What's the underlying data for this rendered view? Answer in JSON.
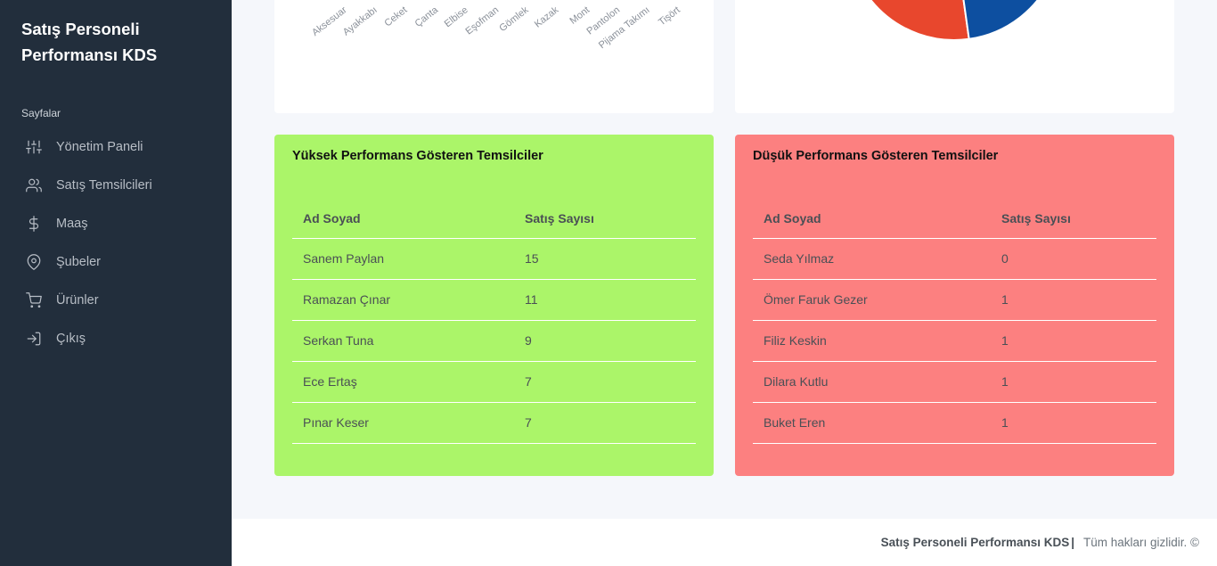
{
  "sidebar": {
    "brand": "Satış Personeli Performansı KDS",
    "header": "Sayfalar",
    "items": [
      {
        "label": "Yönetim Paneli",
        "icon": "sliders-icon"
      },
      {
        "label": "Satış Temsilcileri",
        "icon": "users-icon"
      },
      {
        "label": "Maaş",
        "icon": "dollar-icon"
      },
      {
        "label": "Şubeler",
        "icon": "map-pin-icon"
      },
      {
        "label": "Ürünler",
        "icon": "cart-icon"
      },
      {
        "label": "Çıkış",
        "icon": "log-in-icon"
      }
    ]
  },
  "chart_data": [
    {
      "type": "bar",
      "categories": [
        "Aksesuar",
        "Ayakkabı",
        "Ceket",
        "Çanta",
        "Elbise",
        "Eşofman",
        "Gömlek",
        "Kazak",
        "Mont",
        "Pantolon",
        "Pijama Takımı",
        "Tişört"
      ]
    },
    {
      "type": "pie",
      "colors": [
        "#e8472d",
        "#0d4fa0"
      ]
    }
  ],
  "high_performers": {
    "title": "Yüksek Performans Gösteren Temsilciler",
    "headers": [
      "Ad Soyad",
      "Satış Sayısı"
    ],
    "rows": [
      [
        "Sanem Paylan",
        "15"
      ],
      [
        "Ramazan Çınar",
        "11"
      ],
      [
        "Serkan Tuna",
        "9"
      ],
      [
        "Ece Ertaş",
        "7"
      ],
      [
        "Pınar Keser",
        "7"
      ]
    ],
    "color": "#abf569"
  },
  "low_performers": {
    "title": "Düşük Performans Gösteren Temsilciler",
    "headers": [
      "Ad Soyad",
      "Satış Sayısı"
    ],
    "rows": [
      [
        "Seda Yılmaz",
        "0"
      ],
      [
        "Ömer Faruk Gezer",
        "1"
      ],
      [
        "Filiz Keskin",
        "1"
      ],
      [
        "Dilara Kutlu",
        "1"
      ],
      [
        "Buket Eren",
        "1"
      ]
    ],
    "color": "#fc8080"
  },
  "footer": {
    "brand": "Satış Personeli Performansı KDS",
    "separator": "|",
    "rights": "Tüm hakları gizlidir. ©"
  }
}
